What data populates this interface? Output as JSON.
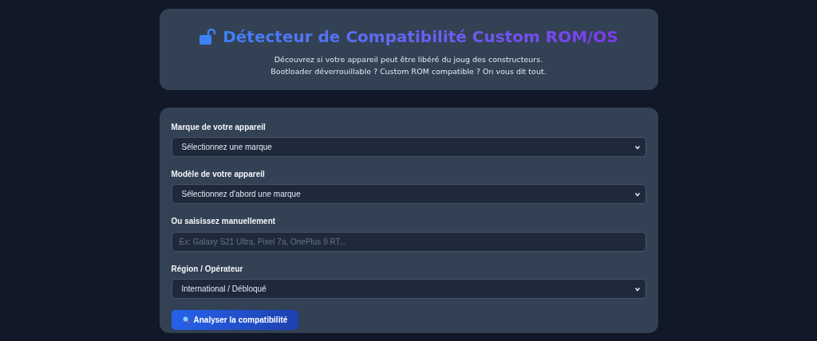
{
  "header": {
    "title": "Détecteur de Compatibilité Custom ROM/OS",
    "subtitle_lines": [
      "Découvrez si votre appareil peut être libéré du joug des constructeurs.",
      "Bootloader déverrouillable ? Custom ROM compatible ? On vous dit tout."
    ]
  },
  "fields": [
    {
      "kind": "select",
      "label": "Marque de votre appareil",
      "value": "Sélectionnez une marque"
    },
    {
      "kind": "select",
      "label": "Modèle de votre appareil",
      "value": "Sélectionnez d'abord une marque"
    },
    {
      "kind": "text",
      "label": "Ou saisissez manuellement",
      "placeholder": "Ex: Galaxy S21 Ultra, Pixel 7a, OnePlus 9 RT..."
    },
    {
      "kind": "select",
      "label": "Région / Opérateur",
      "value": "International / Débloqué"
    }
  ],
  "submit_button": {
    "label": "Analyser la compatibilité"
  }
}
